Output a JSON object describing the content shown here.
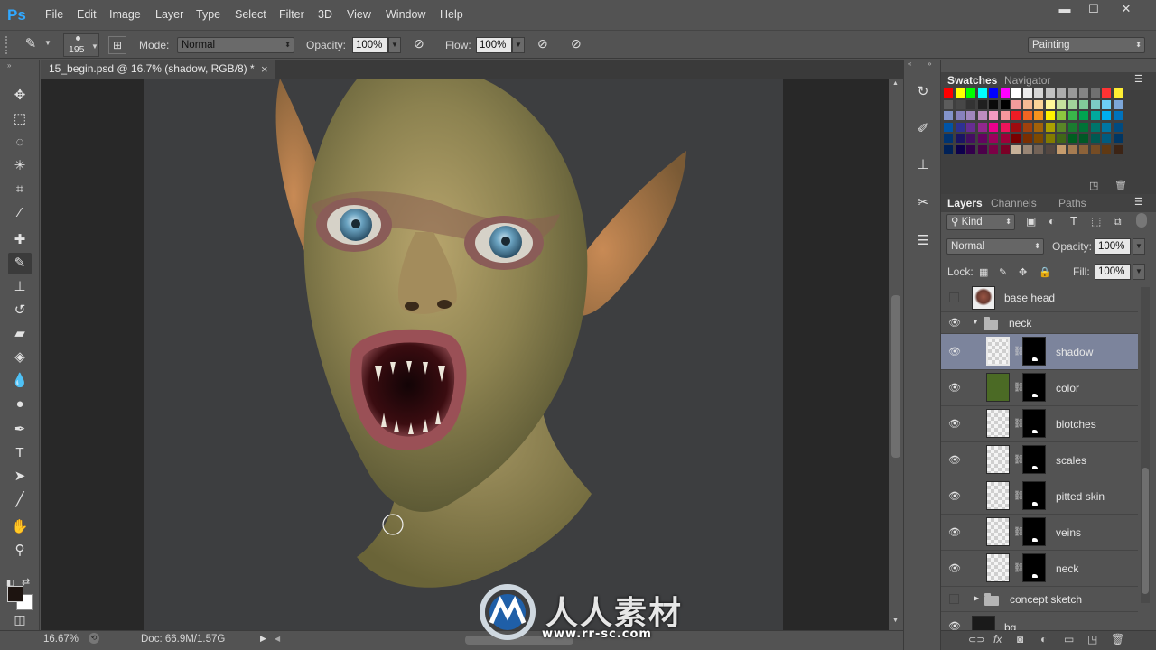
{
  "app": {
    "logo": "Ps"
  },
  "menu": [
    "File",
    "Edit",
    "Image",
    "Layer",
    "Type",
    "Select",
    "Filter",
    "3D",
    "View",
    "Window",
    "Help"
  ],
  "window_controls": {
    "minimize": "▬",
    "maximize": "☐",
    "close": "✕"
  },
  "options_bar": {
    "brush_size": "195",
    "mode_label": "Mode:",
    "mode_value": "Normal",
    "opacity_label": "Opacity:",
    "opacity_value": "100%",
    "flow_label": "Flow:",
    "flow_value": "100%",
    "workspace": "Painting"
  },
  "document": {
    "tab_title": "15_begin.psd @ 16.7% (shadow, RGB/8) *",
    "close": "×"
  },
  "status": {
    "zoom": "16.67%",
    "doc_size": "Doc: 66.9M/1.57G"
  },
  "tools": [
    {
      "name": "move-tool",
      "glyph": "✥"
    },
    {
      "name": "marquee-tool",
      "glyph": "⬚"
    },
    {
      "name": "lasso-tool",
      "glyph": "◌"
    },
    {
      "name": "magic-wand-tool",
      "glyph": "✳"
    },
    {
      "name": "crop-tool",
      "glyph": "⌗"
    },
    {
      "name": "eyedropper-tool",
      "glyph": "⁄"
    },
    {
      "name": "healing-brush-tool",
      "glyph": "✚"
    },
    {
      "name": "brush-tool",
      "glyph": "✎"
    },
    {
      "name": "clone-stamp-tool",
      "glyph": "⊥"
    },
    {
      "name": "history-brush-tool",
      "glyph": "↺"
    },
    {
      "name": "eraser-tool",
      "glyph": "▰"
    },
    {
      "name": "paint-bucket-tool",
      "glyph": "◈"
    },
    {
      "name": "blur-tool",
      "glyph": "💧"
    },
    {
      "name": "dodge-tool",
      "glyph": "●"
    },
    {
      "name": "pen-tool",
      "glyph": "✒"
    },
    {
      "name": "type-tool",
      "glyph": "T"
    },
    {
      "name": "path-selection-tool",
      "glyph": "➤"
    },
    {
      "name": "line-tool",
      "glyph": "╱"
    },
    {
      "name": "hand-tool",
      "glyph": "✋"
    },
    {
      "name": "zoom-tool",
      "glyph": "⚲"
    }
  ],
  "swatches_panel": {
    "tabs": [
      "Swatches",
      "Navigator"
    ],
    "colors": [
      "#ff0000",
      "#ffff00",
      "#00ff00",
      "#00ffff",
      "#0000ff",
      "#ff00ff",
      "#ffffff",
      "#ebebeb",
      "#d6d6d6",
      "#c2c2c2",
      "#adadad",
      "#999999",
      "#858585",
      "#707070",
      "#ff3333",
      "#ffee33",
      "#5c5c5c",
      "#474747",
      "#333333",
      "#1f1f1f",
      "#0a0a0a",
      "#000000",
      "#f29c9c",
      "#f5b995",
      "#fad399",
      "#fff799",
      "#c5e09d",
      "#a1d49a",
      "#81cc99",
      "#7ccbc5",
      "#6dcff6",
      "#7da7d9",
      "#8393ca",
      "#8781bd",
      "#a187be",
      "#bd8cbf",
      "#f49ac1",
      "#f5989d",
      "#ed1c24",
      "#f26522",
      "#f7941d",
      "#fff200",
      "#8dc63f",
      "#39b54a",
      "#00a651",
      "#00a99d",
      "#00aeef",
      "#0072bc",
      "#0054a6",
      "#2e3192",
      "#662d91",
      "#92278f",
      "#ec008c",
      "#ed145b",
      "#9e0b0f",
      "#a0410d",
      "#a36209",
      "#aba000",
      "#598527",
      "#1a7b30",
      "#007236",
      "#00746b",
      "#0076a3",
      "#004b80",
      "#003471",
      "#1b1464",
      "#440e62",
      "#630460",
      "#9e005d",
      "#9e0039",
      "#790000",
      "#7b2e00",
      "#7d4900",
      "#827b00",
      "#406618",
      "#005e20",
      "#005826",
      "#005952",
      "#005b7f",
      "#003663",
      "#002157",
      "#0d004c",
      "#32004b",
      "#4b0049",
      "#7b0046",
      "#7a0026",
      "#c7b299",
      "#998675",
      "#736357",
      "#534741",
      "#c69c6d",
      "#a67c52",
      "#8c6239",
      "#754c24",
      "#603913",
      "#3c2415"
    ]
  },
  "layers_panel": {
    "tabs": [
      "Layers",
      "Channels",
      "Paths"
    ],
    "filter_kind": "Kind",
    "blend_mode": "Normal",
    "opacity_label": "Opacity:",
    "opacity_value": "100%",
    "lock_label": "Lock:",
    "fill_label": "Fill:",
    "fill_value": "100%",
    "layers": [
      {
        "name": "base head",
        "type": "layer",
        "visible": false,
        "thumb": "head"
      },
      {
        "name": "neck",
        "type": "group",
        "visible": true,
        "expanded": true
      },
      {
        "name": "shadow",
        "type": "layer",
        "visible": true,
        "selected": true,
        "thumb": "checker",
        "mask": true
      },
      {
        "name": "color",
        "type": "layer",
        "visible": true,
        "thumb": "#4b6a25",
        "mask": true
      },
      {
        "name": "blotches",
        "type": "layer",
        "visible": true,
        "thumb": "checker",
        "mask": true
      },
      {
        "name": "scales",
        "type": "layer",
        "visible": true,
        "thumb": "checker",
        "mask": true
      },
      {
        "name": "pitted skin",
        "type": "layer",
        "visible": true,
        "thumb": "checker",
        "mask": true
      },
      {
        "name": "veins",
        "type": "layer",
        "visible": true,
        "thumb": "checker",
        "mask": true
      },
      {
        "name": "neck",
        "type": "layer",
        "visible": true,
        "thumb": "checker",
        "mask": true
      },
      {
        "name": "concept sketch",
        "type": "group",
        "visible": false,
        "expanded": false
      },
      {
        "name": "bg",
        "type": "layer",
        "visible": true,
        "thumb": "#1a1a1a"
      }
    ]
  },
  "watermark": {
    "chinese": "人人素材",
    "url": "www.rr-sc.com"
  }
}
